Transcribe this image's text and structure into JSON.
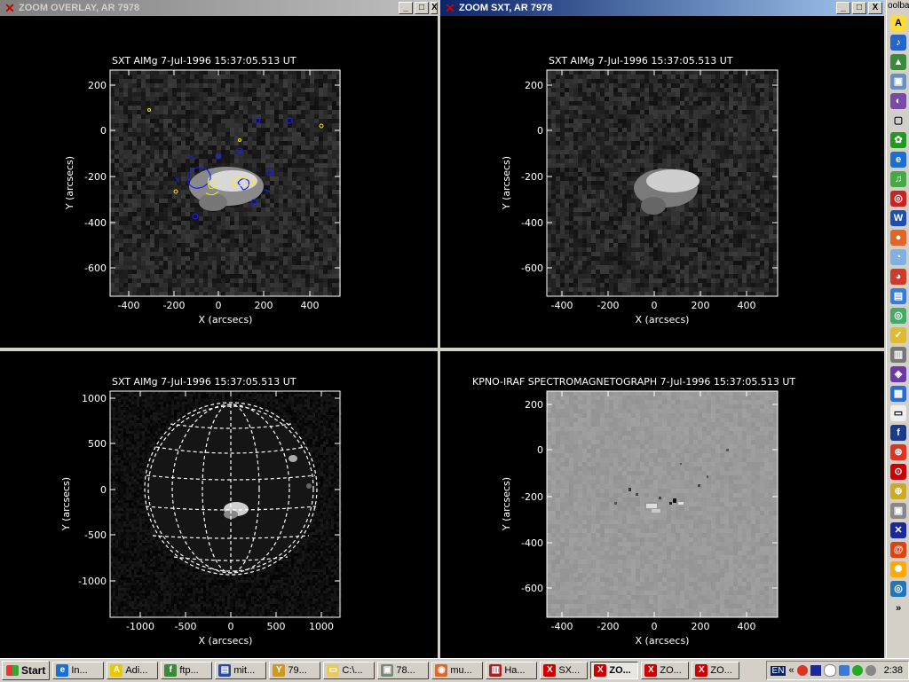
{
  "windows": {
    "overlay_title": "ZOOM OVERLAY, AR 7978",
    "sxt_title": "ZOOM SXT, AR 7978",
    "min_glyph": "_",
    "max_glyph": "□",
    "close_glyph": "X",
    "close_partial": "X"
  },
  "plots": {
    "overlay": {
      "title": "SXT AlMg   7-Jul-1996 15:37:05.513 UT",
      "xlabel": "X (arcsecs)",
      "ylabel": "Y (arcsecs)",
      "xticks": [
        "-400",
        "-200",
        "0",
        "200",
        "400"
      ],
      "yticks": [
        "200",
        "0",
        "-200",
        "-400",
        "-600"
      ]
    },
    "sxt": {
      "title": "SXT AlMg   7-Jul-1996 15:37:05.513 UT",
      "xlabel": "X (arcsecs)",
      "ylabel": "Y (arcsecs)",
      "xticks": [
        "-400",
        "-200",
        "0",
        "200",
        "400"
      ],
      "yticks": [
        "200",
        "0",
        "-200",
        "-400",
        "-600"
      ]
    },
    "fulldisk": {
      "title": "SXT AlMg   7-Jul-1996 15:37:05.513 UT",
      "xlabel": "X (arcsecs)",
      "ylabel": "Y (arcsecs)",
      "xticks": [
        "-1000",
        "-500",
        "0",
        "500",
        "1000"
      ],
      "yticks": [
        "1000",
        "500",
        "0",
        "-500",
        "-1000"
      ]
    },
    "magnetogram": {
      "title": "KPNO-IRAF SPECTROMAGNETOGRAPH  7-Jul-1996 15:37:05.513 UT",
      "xlabel": "X (arcsecs)",
      "ylabel": "Y (arcsecs)",
      "xticks": [
        "-400",
        "-200",
        "0",
        "200",
        "400"
      ],
      "yticks": [
        "200",
        "0",
        "-200",
        "-400",
        "-600"
      ]
    }
  },
  "toolbar": {
    "label": "oolba",
    "icons": [
      "A",
      "♪",
      "▲",
      "▣",
      "◐",
      "▢",
      "✿",
      "e",
      "♫",
      "◎",
      "W",
      "●",
      "◔",
      "◕",
      "▤",
      "◎",
      "✓",
      "▥",
      "◈",
      "▦",
      "▭",
      "f",
      "⊛",
      "⊙",
      "⊕",
      "▣",
      "✕",
      "@",
      "✺",
      "◎",
      "»"
    ],
    "colors": [
      "#ffdd33",
      "#2266cc",
      "#3a8a3a",
      "#6b8fbf",
      "#7a4aa8",
      "#cfcfcf",
      "#229922",
      "#1a6fd1",
      "#44aa44",
      "#cc2222",
      "#1b4fb0",
      "#e0662a",
      "#7fb0e0",
      "#d03a2a",
      "#3a7bd5",
      "#44aa66",
      "#ddbb33",
      "#777777",
      "#6b3aa8",
      "#2a6cd1",
      "#eeeeee",
      "#1a3a8a",
      "#dd3322",
      "#cc0000",
      "#ccaa22",
      "#888888",
      "#1a2a9a",
      "#dd4411",
      "#ffaa00",
      "#2277bb",
      "#d4d0c8"
    ]
  },
  "taskbar": {
    "start": "Start",
    "tasks": [
      {
        "label": "In...",
        "icon": "e",
        "color": "#1a6fd1"
      },
      {
        "label": "Adi...",
        "icon": "A",
        "color": "#e8c800"
      },
      {
        "label": "ftp...",
        "icon": "f",
        "color": "#3a8a3a"
      },
      {
        "label": "mit...",
        "icon": "▤",
        "color": "#2a4a9a"
      },
      {
        "label": "79...",
        "icon": "Y",
        "color": "#cc9922"
      },
      {
        "label": "C:\\...",
        "icon": "▭",
        "color": "#e8c860"
      },
      {
        "label": "78...",
        "icon": "▣",
        "color": "#7a8a7a"
      },
      {
        "label": "mu...",
        "icon": "◉",
        "color": "#e0662a"
      },
      {
        "label": "Ha...",
        "icon": "▥",
        "color": "#aa2222"
      },
      {
        "label": "SX...",
        "icon": "X",
        "color": "#cc0000"
      },
      {
        "label": "ZO...",
        "icon": "X",
        "color": "#cc0000"
      },
      {
        "label": "ZO...",
        "icon": "X",
        "color": "#cc0000"
      },
      {
        "label": "ZO...",
        "icon": "X",
        "color": "#cc0000"
      }
    ],
    "lang": "EN",
    "chevron": "«",
    "clock": "2:38"
  }
}
